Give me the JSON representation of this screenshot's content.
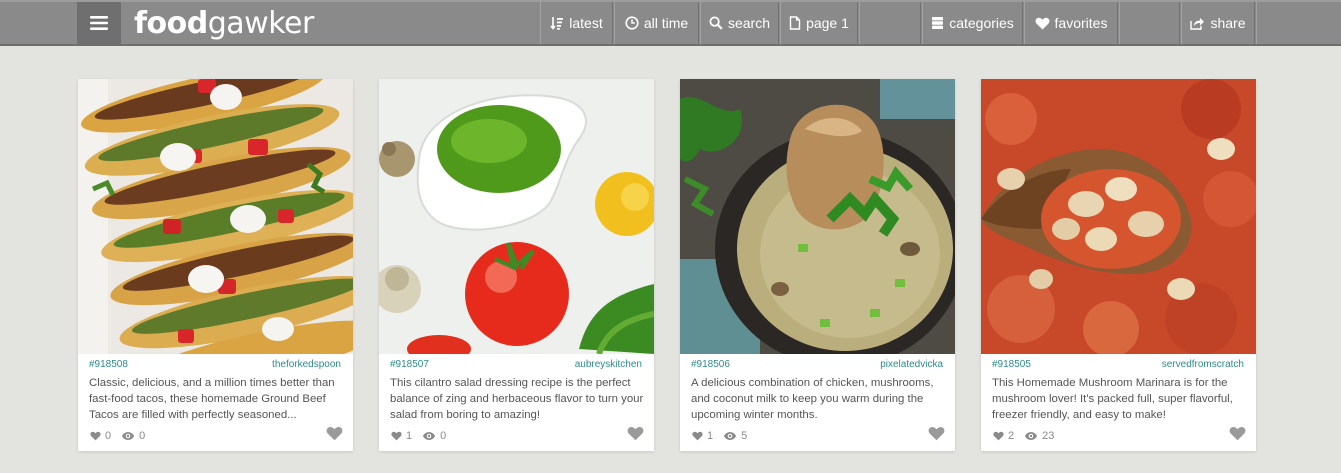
{
  "header": {
    "logo_bold": "food",
    "logo_light": "gawker",
    "nav": {
      "latest": "latest",
      "all_time": "all time",
      "search": "search",
      "page": "page 1",
      "categories": "categories",
      "favorites": "favorites",
      "share": "share"
    }
  },
  "colors": {
    "topbar": "#8a8a8a",
    "background": "#e3e3df",
    "link_teal": "#2e8a8a"
  },
  "cards": [
    {
      "id": "#918508",
      "author": "theforkedspoon",
      "description": "Classic, delicious, and a million times better than fast-food tacos, these homemade Ground Beef Tacos are filled with perfectly seasoned...",
      "likes": "0",
      "views": "0",
      "image": "ground beef tacos photo"
    },
    {
      "id": "#918507",
      "author": "aubreyskitchen",
      "description": "This cilantro salad dressing recipe is the perfect balance of zing and herbaceous flavor to turn your salad from boring to amazing!",
      "likes": "1",
      "views": "0",
      "image": "cilantro dressing photo"
    },
    {
      "id": "#918506",
      "author": "pixelatedvicka",
      "description": "A delicious combination of chicken, mushrooms, and coconut milk to keep you warm during the upcoming winter months.",
      "likes": "1",
      "views": "5",
      "image": "chicken mushroom coconut soup photo"
    },
    {
      "id": "#918505",
      "author": "servedfromscratch",
      "description": "This Homemade Mushroom Marinara is for the mushroom lover! It's packed full, super flavorful, freezer friendly, and easy to make!",
      "likes": "2",
      "views": "23",
      "image": "mushroom marinara photo"
    }
  ]
}
